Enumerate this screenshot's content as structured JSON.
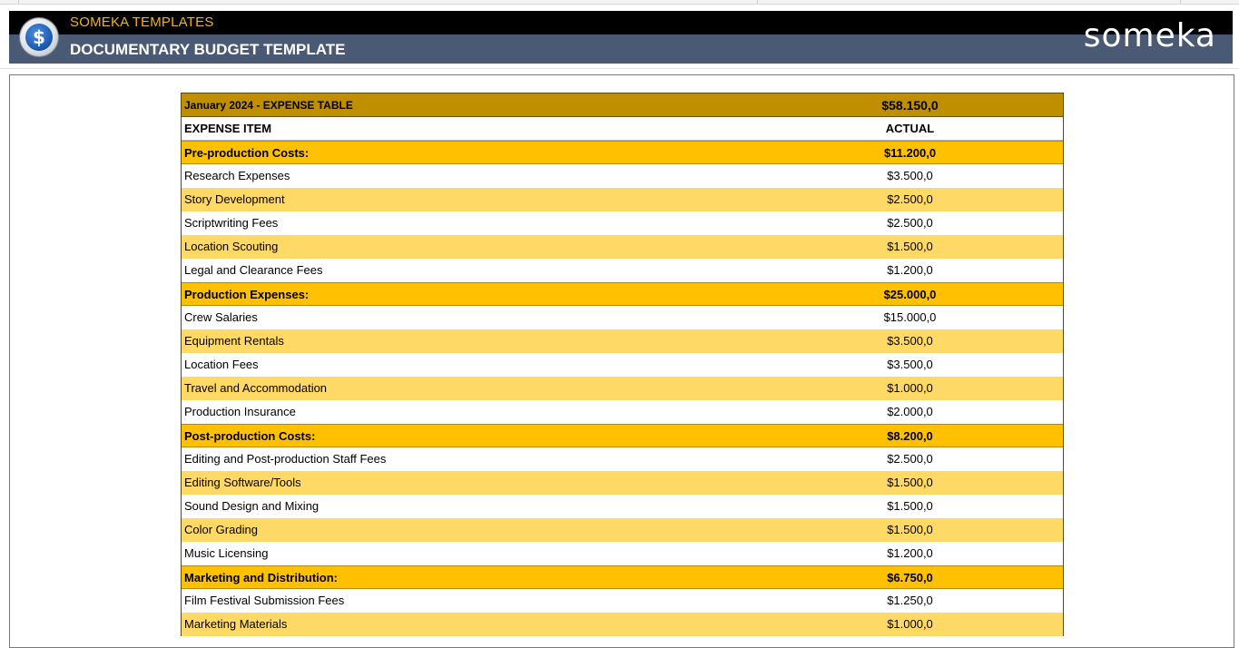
{
  "header": {
    "brand_top": "SOMEKA TEMPLATES",
    "title": "DOCUMENTARY BUDGET TEMPLATE",
    "wordmark": "someka",
    "logo_icon": "dollar-coin-icon",
    "logo_glyph": "$"
  },
  "colors": {
    "header_band": "#000000",
    "header_bg": "#4a5a74",
    "brand_accent": "#f0b323",
    "title_row": "#c08f00",
    "category_row": "#ffc000",
    "alt_row": "#ffd966"
  },
  "table": {
    "title": "January 2024 - EXPENSE TABLE",
    "total": "$58.150,0",
    "col_item": "EXPENSE ITEM",
    "col_actual": "ACTUAL",
    "rows": [
      {
        "type": "cat",
        "label": "Pre-production Costs:",
        "value": "$11.200,0"
      },
      {
        "type": "item",
        "label": "Research Expenses",
        "value": "$3.500,0"
      },
      {
        "type": "item",
        "label": "Story Development",
        "value": "$2.500,0"
      },
      {
        "type": "item",
        "label": "Scriptwriting Fees",
        "value": "$2.500,0"
      },
      {
        "type": "item",
        "label": "Location Scouting",
        "value": "$1.500,0"
      },
      {
        "type": "item",
        "label": "Legal and Clearance Fees",
        "value": "$1.200,0"
      },
      {
        "type": "cat",
        "label": "Production Expenses:",
        "value": "$25.000,0"
      },
      {
        "type": "item",
        "label": "Crew Salaries",
        "value": "$15.000,0"
      },
      {
        "type": "item",
        "label": "Equipment Rentals",
        "value": "$3.500,0"
      },
      {
        "type": "item",
        "label": "Location Fees",
        "value": "$3.500,0"
      },
      {
        "type": "item",
        "label": "Travel and Accommodation",
        "value": "$1.000,0"
      },
      {
        "type": "item",
        "label": "Production Insurance",
        "value": "$2.000,0"
      },
      {
        "type": "cat",
        "label": "Post-production Costs:",
        "value": "$8.200,0"
      },
      {
        "type": "item",
        "label": "Editing and Post-production Staff Fees",
        "value": "$2.500,0"
      },
      {
        "type": "item",
        "label": "Editing Software/Tools",
        "value": "$1.500,0"
      },
      {
        "type": "item",
        "label": "Sound Design and Mixing",
        "value": "$1.500,0"
      },
      {
        "type": "item",
        "label": "Color Grading",
        "value": "$1.500,0"
      },
      {
        "type": "item",
        "label": "Music Licensing",
        "value": "$1.200,0"
      },
      {
        "type": "cat",
        "label": "Marketing and Distribution:",
        "value": "$6.750,0"
      },
      {
        "type": "item",
        "label": "Film Festival Submission Fees",
        "value": "$1.250,0"
      },
      {
        "type": "item",
        "label": "Marketing Materials",
        "value": "$1.000,0"
      }
    ]
  }
}
